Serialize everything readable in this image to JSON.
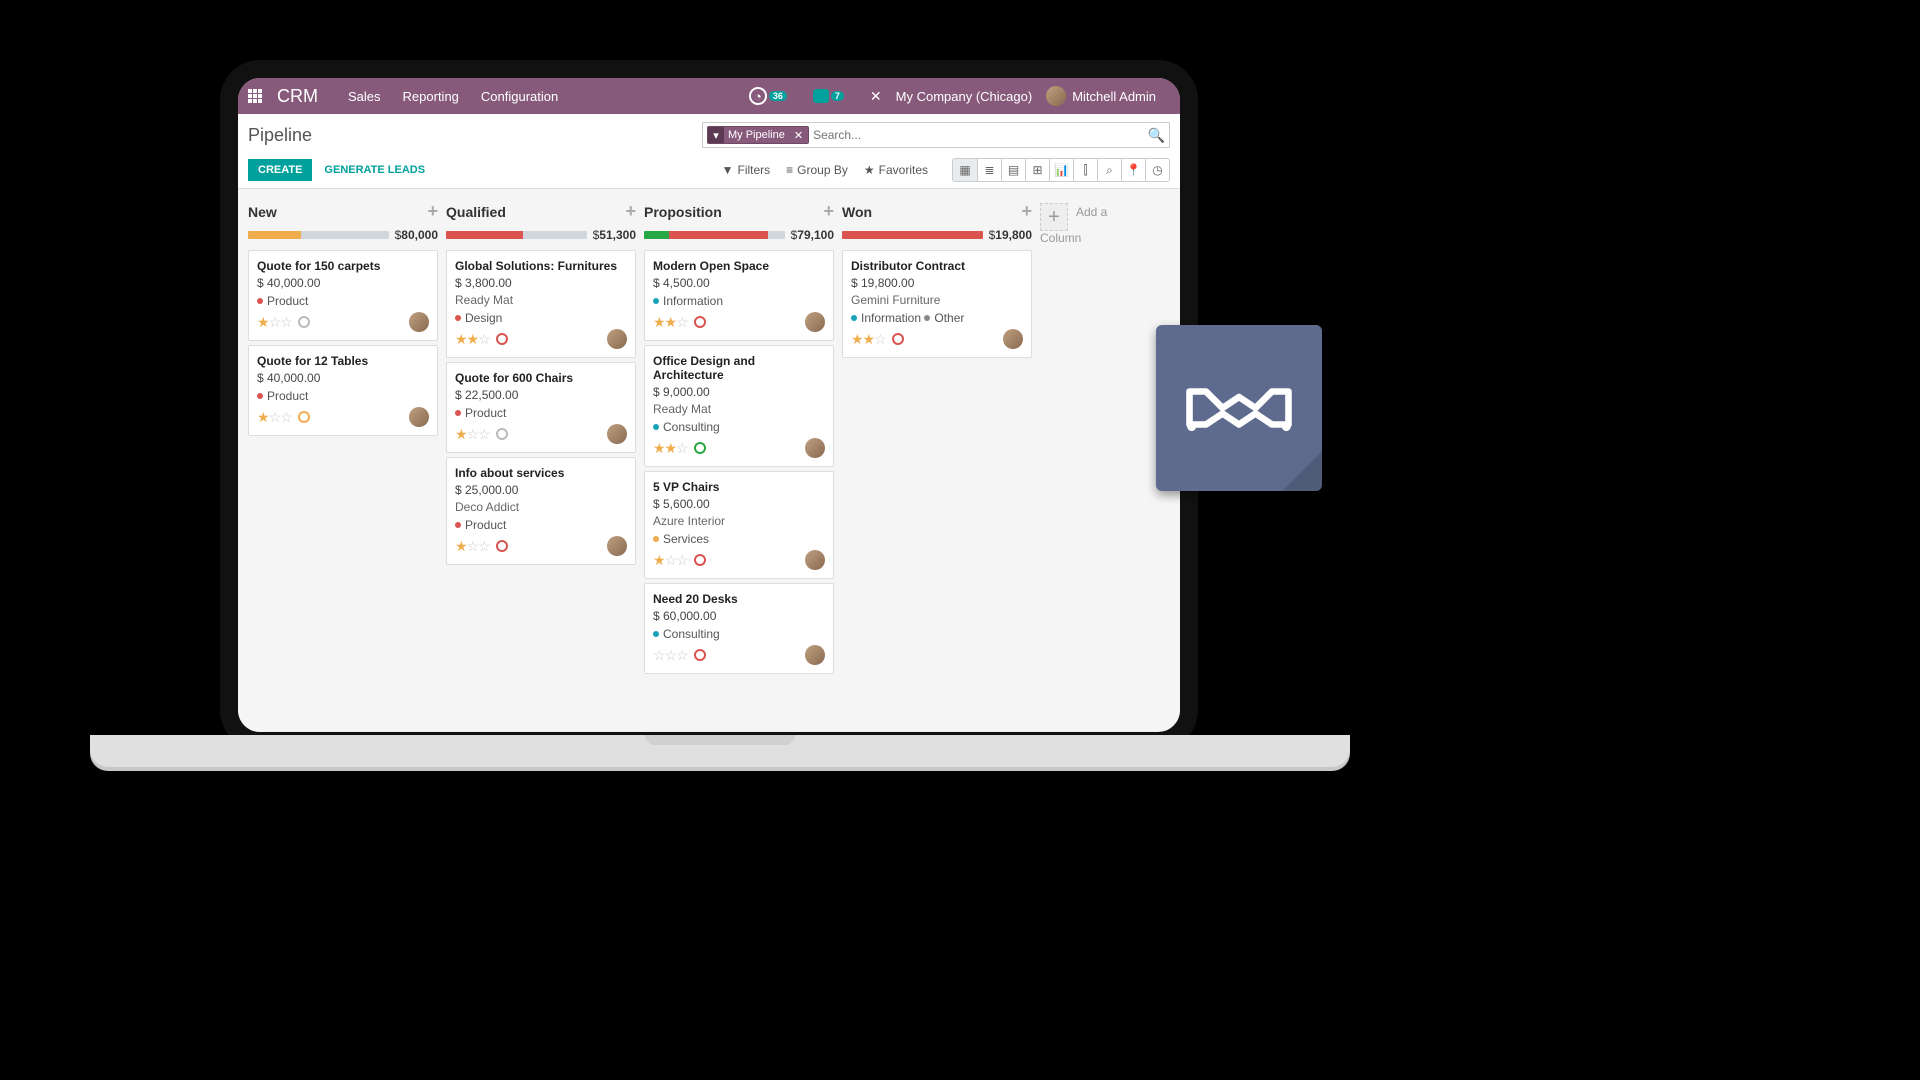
{
  "nav": {
    "brand": "CRM",
    "items": [
      "Sales",
      "Reporting",
      "Configuration"
    ],
    "activity_count": "36",
    "message_count": "7",
    "company": "My Company (Chicago)",
    "user": "Mitchell Admin"
  },
  "page": {
    "title": "Pipeline",
    "filter_chip": "My Pipeline",
    "search_placeholder": "Search...",
    "create": "CREATE",
    "generate": "GENERATE LEADS",
    "filters": "Filters",
    "groupby": "Group By",
    "favorites": "Favorites",
    "add_column": "Add a Column"
  },
  "columns": [
    {
      "name": "New",
      "total": "80,000",
      "bar": [
        [
          "o",
          38
        ]
      ],
      "cards": [
        {
          "title": "Quote for 150 carpets",
          "amount": "$ 40,000.00",
          "sub": "",
          "tags": [
            [
              "Product",
              "red"
            ]
          ],
          "stars": 1,
          "ring": "grey"
        },
        {
          "title": "Quote for 12 Tables",
          "amount": "$ 40,000.00",
          "sub": "",
          "tags": [
            [
              "Product",
              "red"
            ]
          ],
          "stars": 1,
          "ring": "orange"
        }
      ]
    },
    {
      "name": "Qualified",
      "total": "51,300",
      "bar": [
        [
          "r",
          55
        ]
      ],
      "cards": [
        {
          "title": "Global Solutions: Furnitures",
          "amount": "$ 3,800.00",
          "sub": "Ready Mat",
          "tags": [
            [
              "Design",
              "red"
            ]
          ],
          "stars": 2,
          "ring": "red"
        },
        {
          "title": "Quote for 600 Chairs",
          "amount": "$ 22,500.00",
          "sub": "",
          "tags": [
            [
              "Product",
              "red"
            ]
          ],
          "stars": 1,
          "ring": "grey"
        },
        {
          "title": "Info about services",
          "amount": "$ 25,000.00",
          "sub": "Deco Addict",
          "tags": [
            [
              "Product",
              "red"
            ]
          ],
          "stars": 1,
          "ring": "red"
        }
      ]
    },
    {
      "name": "Proposition",
      "total": "79,100",
      "bar": [
        [
          "g",
          18
        ],
        [
          "r",
          70
        ]
      ],
      "cards": [
        {
          "title": "Modern Open Space",
          "amount": "$ 4,500.00",
          "sub": "",
          "tags": [
            [
              "Information",
              "blue"
            ]
          ],
          "stars": 2,
          "ring": "red"
        },
        {
          "title": "Office Design and Architecture",
          "amount": "$ 9,000.00",
          "sub": "Ready Mat",
          "tags": [
            [
              "Consulting",
              "blue"
            ]
          ],
          "stars": 2,
          "ring": "green"
        },
        {
          "title": "5 VP Chairs",
          "amount": "$ 5,600.00",
          "sub": "Azure Interior",
          "tags": [
            [
              "Services",
              "yellow"
            ]
          ],
          "stars": 1,
          "ring": "red"
        },
        {
          "title": "Need 20 Desks",
          "amount": "$ 60,000.00",
          "sub": "",
          "tags": [
            [
              "Consulting",
              "blue"
            ]
          ],
          "stars": 0,
          "ring": "red"
        }
      ]
    },
    {
      "name": "Won",
      "total": "19,800",
      "bar": [
        [
          "r",
          100
        ]
      ],
      "cards": [
        {
          "title": "Distributor Contract",
          "amount": "$ 19,800.00",
          "sub": "Gemini Furniture",
          "tags": [
            [
              "Information",
              "blue"
            ],
            [
              "Other",
              "grey"
            ]
          ],
          "stars": 2,
          "ring": "red"
        }
      ]
    }
  ]
}
